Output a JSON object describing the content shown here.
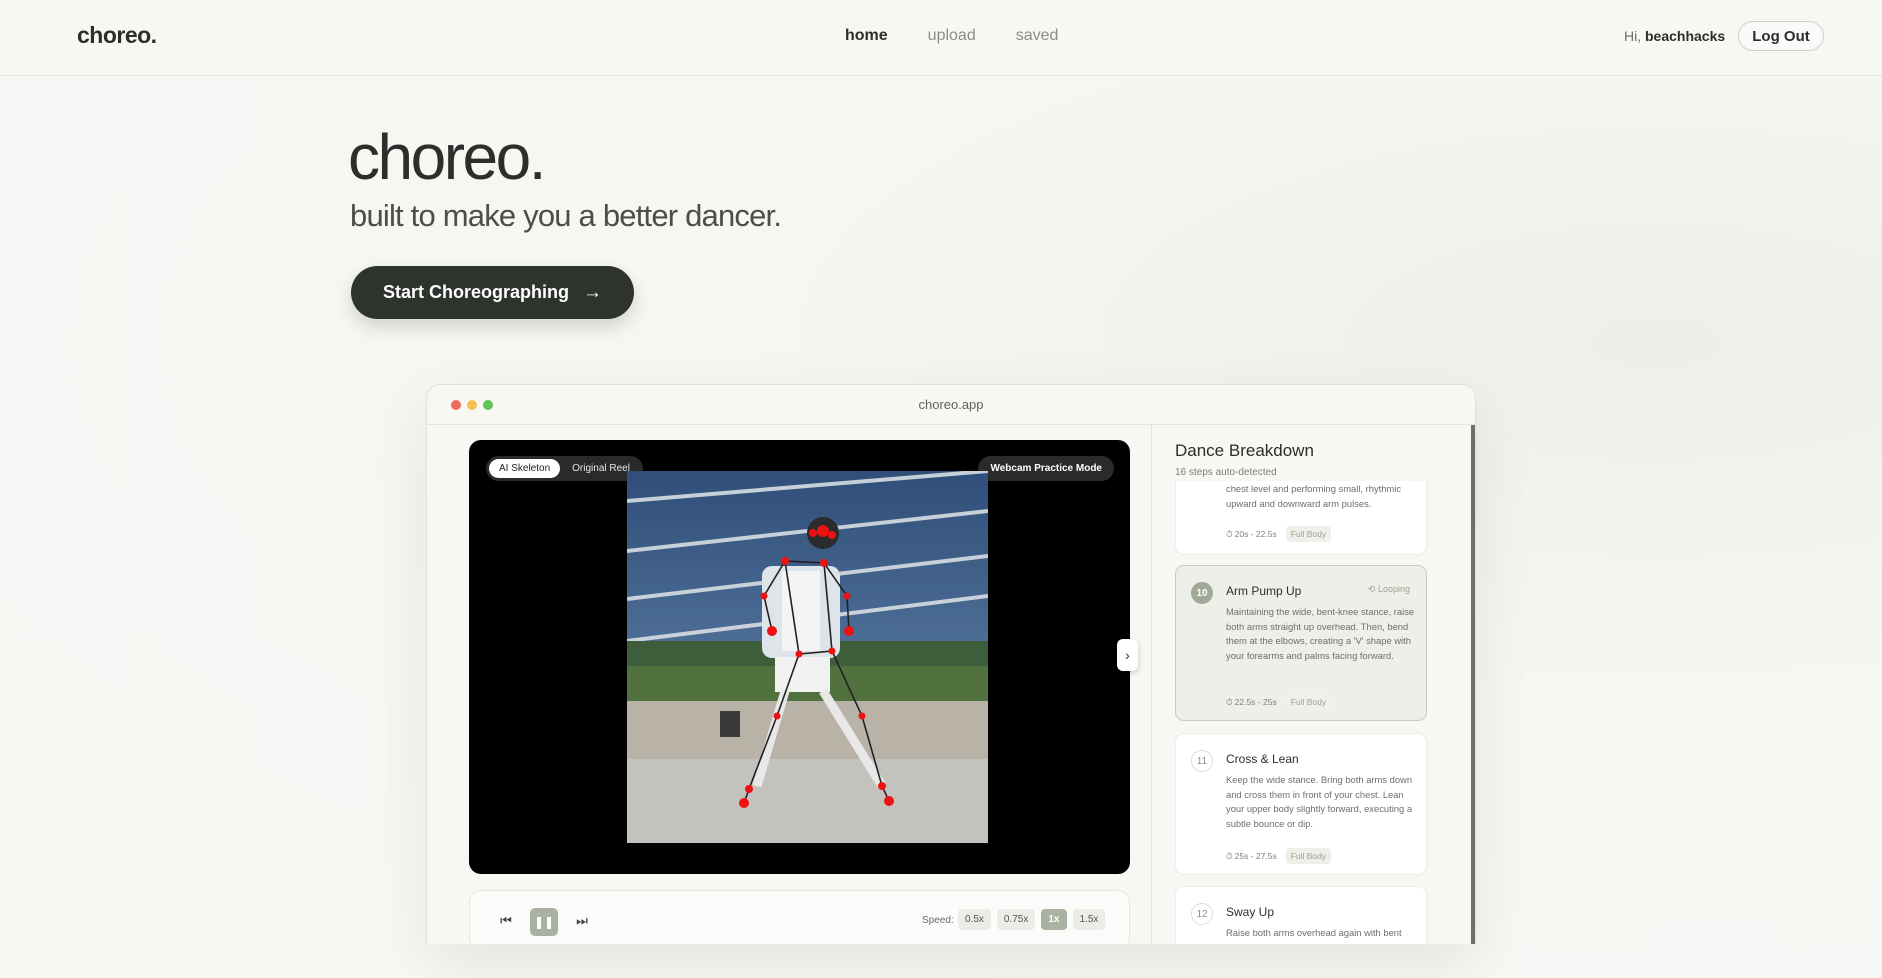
{
  "nav": {
    "logo": "choreo.",
    "links": [
      "home",
      "upload",
      "saved"
    ],
    "active": "home",
    "greeting_prefix": "Hi, ",
    "username": "beachhacks",
    "logout_label": "Log Out"
  },
  "hero": {
    "title": "choreo.",
    "subtitle": "built to make you a better dancer.",
    "cta_label": "Start Choreographing",
    "cta_icon": "arrow-right-icon"
  },
  "browser": {
    "url": "choreo.app",
    "dots": [
      "#ed6a5e",
      "#f5bf4f",
      "#61c554"
    ]
  },
  "video": {
    "view_modes": [
      "AI Skeleton",
      "Original Reel"
    ],
    "active_view": "AI Skeleton",
    "webcam_label": "Webcam Practice Mode"
  },
  "controls": {
    "speed_label": "Speed:",
    "speeds": [
      "0.5x",
      "0.75x",
      "1x",
      "1.5x"
    ],
    "active_speed": "1x"
  },
  "breakdown": {
    "title": "Dance Breakdown",
    "subtitle": "16 steps auto-detected",
    "steps": [
      {
        "num": "",
        "title": "",
        "desc": "chest level and performing small, rhythmic upward and downward arm pulses.",
        "time": "20s - 22.5s",
        "tag": "Full Body"
      },
      {
        "num": "10",
        "title": "Arm Pump Up",
        "status": "Looping",
        "desc": "Maintaining the wide, bent-knee stance, raise both arms straight up overhead. Then, bend them at the elbows, creating a 'V' shape with your forearms and palms facing forward.",
        "time": "22.5s - 25s",
        "tag": "Full Body"
      },
      {
        "num": "11",
        "title": "Cross & Lean",
        "desc": "Keep the wide stance. Bring both arms down and cross them in front of your chest. Lean your upper body slightly forward, executing a subtle bounce or dip.",
        "time": "25s - 27.5s",
        "tag": "Full Body"
      },
      {
        "num": "12",
        "title": "Sway Up",
        "desc": "Raise both arms overhead again with bent"
      }
    ]
  },
  "colors": {
    "accent": "#2e332e",
    "sage": "#a9b2a0",
    "background": "#f7f7f4"
  }
}
